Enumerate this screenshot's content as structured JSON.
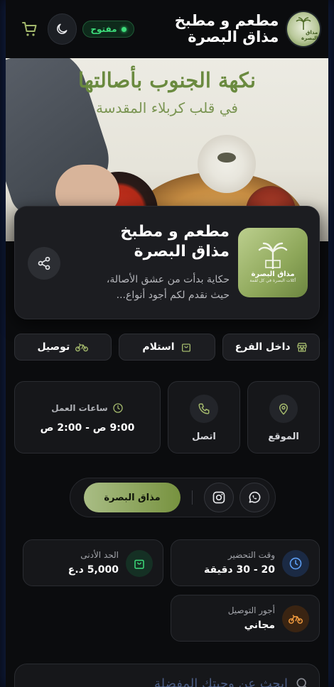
{
  "header": {
    "logo_text": "مذاق البصرة",
    "title": "مطعم و مطبخ مذاق البصرة",
    "status": "مفتوح",
    "colors": {
      "open": "#3ddc7a",
      "accent": "#a3b86c"
    }
  },
  "hero": {
    "headline": "نكهة الجنوب بأصالتها",
    "subline": "في قلب كربلاء المقدسة"
  },
  "card": {
    "logo_name": "مذاق البصرة",
    "logo_tagline": "أكلات البصرة في كل لقمة",
    "title": "مطعم و مطبخ مذاق البصرة",
    "description": "حكاية بدأت من عشق الأصالة، حيث نقدم لكم أجود أنواع..."
  },
  "services": [
    {
      "label": "داخل الفرع",
      "icon": "store-icon"
    },
    {
      "label": "استلام",
      "icon": "bag-icon"
    },
    {
      "label": "توصيل",
      "icon": "bike-icon"
    }
  ],
  "tiles": {
    "location": "الموقع",
    "call": "اتصل",
    "hours_label": "ساعات العمل",
    "hours_value": "9:00 ص - 2:00 ص"
  },
  "social": {
    "brand_label": "مذاق البصرة",
    "icons": [
      "whatsapp-icon",
      "instagram-icon"
    ]
  },
  "stats": {
    "prep_label": "وقت التحضير",
    "prep_value": "20 - 30 دقيقة",
    "min_label": "الحد الأدنى",
    "min_value": "5,000 د.ع",
    "delivery_label": "أجور التوصيل",
    "delivery_value": "مجاني"
  },
  "search": {
    "placeholder": "ابحث عن وجبتك المفضلة"
  }
}
